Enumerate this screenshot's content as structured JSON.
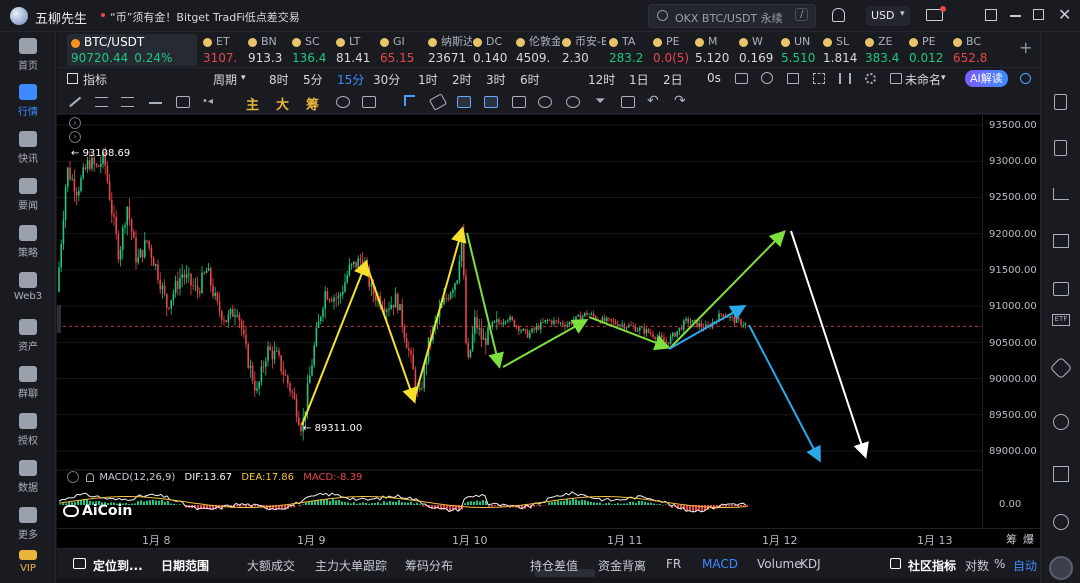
{
  "app": {
    "name": "五柳先生",
    "notice": "“币”须有金！Bitget TradFi低点差交易"
  },
  "search": {
    "placeholder": "OKX BTC/USDT 永续",
    "shortcut": "/"
  },
  "currency": "USD",
  "leftnav": [
    {
      "label": "首页",
      "icon": "home-icon"
    },
    {
      "label": "行情",
      "icon": "market-chart-icon",
      "active": true
    },
    {
      "label": "快讯",
      "icon": "flash-news-icon"
    },
    {
      "label": "要闻",
      "icon": "news-icon"
    },
    {
      "label": "策略",
      "icon": "strategy-robot-icon"
    },
    {
      "label": "Web3",
      "icon": "web3-icon"
    },
    {
      "label": "资产",
      "icon": "wallet-icon"
    },
    {
      "label": "群聊",
      "icon": "group-chat-icon"
    },
    {
      "label": "授权",
      "icon": "authorize-icon"
    },
    {
      "label": "数据",
      "icon": "data-icon"
    },
    {
      "label": "更多",
      "icon": "more-icon"
    },
    {
      "label": "VIP",
      "icon": "vip-crown-icon"
    }
  ],
  "tickers": [
    {
      "name": "BTC/USDT",
      "price": "90720.44",
      "change": "0.24%",
      "color": "#1fc77e"
    },
    {
      "name": "ET",
      "price": "3107.",
      "color": "#e9454a"
    },
    {
      "name": "BN",
      "price": "913.3",
      "color": "#d6d9df"
    },
    {
      "name": "SC",
      "price": "136.4",
      "color": "#1fc77e"
    },
    {
      "name": "LT",
      "price": "81.41",
      "color": "#d6d9df"
    },
    {
      "name": "GI",
      "price": "65.15",
      "color": "#e9454a"
    },
    {
      "name": "纳斯达",
      "price": "23671",
      "color": "#d6d9df"
    },
    {
      "name": "DC",
      "price": "0.140",
      "color": "#d6d9df"
    },
    {
      "name": "伦敦金",
      "price": "4509.",
      "color": "#d6d9df"
    },
    {
      "name": "币安-B",
      "price": "2.30",
      "color": "#d6d9df"
    },
    {
      "name": "TA",
      "price": "283.2",
      "color": "#1fc77e"
    },
    {
      "name": "PE",
      "price": "0.0(5)",
      "color": "#e9454a"
    },
    {
      "name": "M",
      "price": "5.120",
      "color": "#d6d9df"
    },
    {
      "name": "W",
      "price": "0.169",
      "color": "#d6d9df"
    },
    {
      "name": "UN",
      "price": "5.510",
      "color": "#1fc77e"
    },
    {
      "name": "SL",
      "price": "1.814",
      "color": "#d6d9df"
    },
    {
      "name": "ZE",
      "price": "383.4",
      "color": "#1fc77e"
    },
    {
      "name": "PE",
      "price": "0.012",
      "color": "#1fc77e"
    },
    {
      "name": "BC",
      "price": "652.8",
      "color": "#e9454a"
    }
  ],
  "toolbar": {
    "indicator": "指标",
    "period": "周期",
    "intervals": [
      "8时",
      "5分",
      "15分",
      "30分",
      "1时",
      "2时",
      "3时",
      "6时",
      "12时",
      "1日",
      "2日",
      "0s"
    ],
    "active_interval": "15分",
    "unnamed": "未命名",
    "ai": "AI解读"
  },
  "drawbar": {
    "main": "主",
    "big": "大",
    "chip": "筹"
  },
  "chart": {
    "high_label": "93108.69",
    "low_label": "89311.00",
    "macd_legend": {
      "name": "MACD(12,26,9)",
      "dif": "DIF:13.67",
      "dea": "DEA:17.86",
      "macd": "MACD:-8.39"
    },
    "watermark": "AiCoin"
  },
  "chart_data": {
    "type": "line",
    "y_ticks": [
      "93500.00",
      "93000.00",
      "92500.00",
      "92000.00",
      "91500.00",
      "91000.00",
      "90500.00",
      "90000.00",
      "89500.00",
      "89000.00"
    ],
    "macd_ticks": [
      "0.00"
    ],
    "x_ticks": [
      "1月 8",
      "1月 9",
      "1月 10",
      "1月 11",
      "1月 12",
      "1月 13"
    ],
    "current_price": 90720.44,
    "colors": {
      "up": "#1fc77e",
      "down": "#e9454a"
    }
  },
  "yaxis_extra": {
    "left": "筹",
    "right": "爆"
  },
  "bottombar": {
    "items": [
      "定位到...",
      "日期范围",
      "大额成交",
      "主力大单跟踪",
      "筹码分布",
      "持仓差值",
      "资金背离",
      "FR",
      "MACD",
      "Volume",
      "KDJ",
      "社区指标",
      "对数",
      "%",
      "自动"
    ],
    "active": "MACD"
  }
}
